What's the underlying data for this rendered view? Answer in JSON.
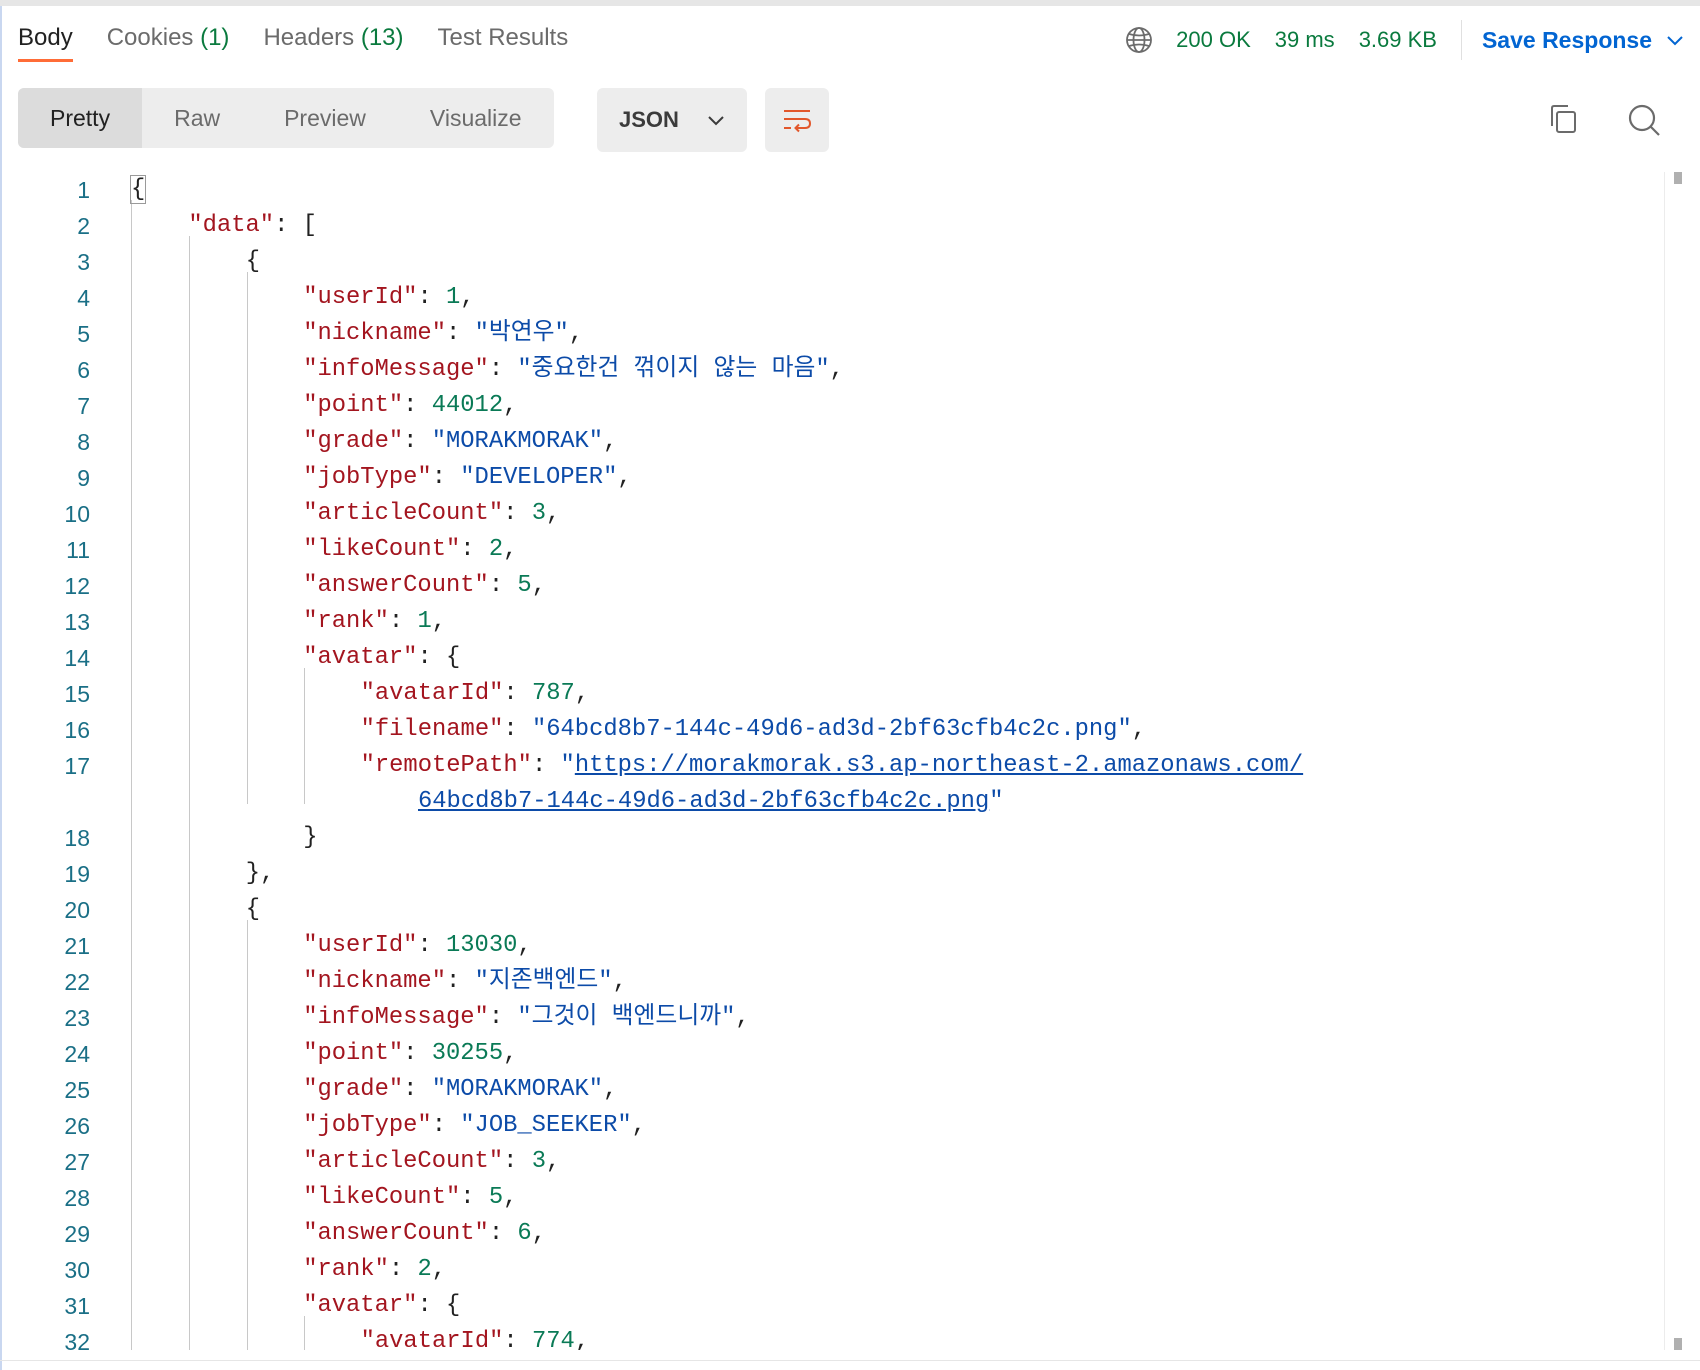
{
  "tabs": {
    "body": "Body",
    "cookies": "Cookies",
    "cookies_count": "(1)",
    "headers": "Headers",
    "headers_count": "(13)",
    "test_results": "Test Results"
  },
  "status": {
    "code": "200 OK",
    "time": "39 ms",
    "size": "3.69 KB",
    "save_label": "Save Response"
  },
  "toolbar": {
    "views": [
      "Pretty",
      "Raw",
      "Preview",
      "Visualize"
    ],
    "active_view": "Pretty",
    "format": "JSON"
  },
  "colors": {
    "key": "#a3151f",
    "string": "#0c4ba8",
    "number": "#0a7a56",
    "status_ok": "#0a7a3e",
    "accent": "#ff6c37",
    "link": "#0265d2"
  },
  "icons": {
    "globe": "globe-icon",
    "chevron": "chevron-down-icon",
    "wrap": "wrap-lines-icon",
    "copy": "copy-icon",
    "search": "search-icon"
  },
  "lines": [
    {
      "n": "1",
      "indent": 0,
      "t": [
        [
          "p",
          "{"
        ]
      ]
    },
    {
      "n": "2",
      "indent": 1,
      "t": [
        [
          "k",
          "\"data\""
        ],
        [
          "p",
          ": ["
        ]
      ]
    },
    {
      "n": "3",
      "indent": 2,
      "t": [
        [
          "p",
          "{"
        ]
      ]
    },
    {
      "n": "4",
      "indent": 3,
      "t": [
        [
          "k",
          "\"userId\""
        ],
        [
          "p",
          ": "
        ],
        [
          "n",
          "1"
        ],
        [
          "p",
          ","
        ]
      ]
    },
    {
      "n": "5",
      "indent": 3,
      "t": [
        [
          "k",
          "\"nickname\""
        ],
        [
          "p",
          ": "
        ],
        [
          "s",
          "\"박연우\""
        ],
        [
          "p",
          ","
        ]
      ]
    },
    {
      "n": "6",
      "indent": 3,
      "t": [
        [
          "k",
          "\"infoMessage\""
        ],
        [
          "p",
          ": "
        ],
        [
          "s",
          "\"중요한건 꺾이지 않는 마음\""
        ],
        [
          "p",
          ","
        ]
      ]
    },
    {
      "n": "7",
      "indent": 3,
      "t": [
        [
          "k",
          "\"point\""
        ],
        [
          "p",
          ": "
        ],
        [
          "n",
          "44012"
        ],
        [
          "p",
          ","
        ]
      ]
    },
    {
      "n": "8",
      "indent": 3,
      "t": [
        [
          "k",
          "\"grade\""
        ],
        [
          "p",
          ": "
        ],
        [
          "s",
          "\"MORAKMORAK\""
        ],
        [
          "p",
          ","
        ]
      ]
    },
    {
      "n": "9",
      "indent": 3,
      "t": [
        [
          "k",
          "\"jobType\""
        ],
        [
          "p",
          ": "
        ],
        [
          "s",
          "\"DEVELOPER\""
        ],
        [
          "p",
          ","
        ]
      ]
    },
    {
      "n": "10",
      "indent": 3,
      "t": [
        [
          "k",
          "\"articleCount\""
        ],
        [
          "p",
          ": "
        ],
        [
          "n",
          "3"
        ],
        [
          "p",
          ","
        ]
      ]
    },
    {
      "n": "11",
      "indent": 3,
      "t": [
        [
          "k",
          "\"likeCount\""
        ],
        [
          "p",
          ": "
        ],
        [
          "n",
          "2"
        ],
        [
          "p",
          ","
        ]
      ]
    },
    {
      "n": "12",
      "indent": 3,
      "t": [
        [
          "k",
          "\"answerCount\""
        ],
        [
          "p",
          ": "
        ],
        [
          "n",
          "5"
        ],
        [
          "p",
          ","
        ]
      ]
    },
    {
      "n": "13",
      "indent": 3,
      "t": [
        [
          "k",
          "\"rank\""
        ],
        [
          "p",
          ": "
        ],
        [
          "n",
          "1"
        ],
        [
          "p",
          ","
        ]
      ]
    },
    {
      "n": "14",
      "indent": 3,
      "t": [
        [
          "k",
          "\"avatar\""
        ],
        [
          "p",
          ": {"
        ]
      ]
    },
    {
      "n": "15",
      "indent": 4,
      "t": [
        [
          "k",
          "\"avatarId\""
        ],
        [
          "p",
          ": "
        ],
        [
          "n",
          "787"
        ],
        [
          "p",
          ","
        ]
      ]
    },
    {
      "n": "16",
      "indent": 4,
      "t": [
        [
          "k",
          "\"filename\""
        ],
        [
          "p",
          ": "
        ],
        [
          "s",
          "\"64bcd8b7-144c-49d6-ad3d-2bf63cfb4c2c.png\""
        ],
        [
          "p",
          ","
        ]
      ]
    },
    {
      "n": "17",
      "indent": 4,
      "wrap": true,
      "t": [
        [
          "k",
          "\"remotePath\""
        ],
        [
          "p",
          ": "
        ],
        [
          "s",
          "\""
        ],
        [
          "url",
          "https://morakmorak.s3.ap-northeast-2.amazonaws.com/"
        ]
      ],
      "t2": [
        [
          "url",
          "64bcd8b7-144c-49d6-ad3d-2bf63cfb4c2c.png"
        ],
        [
          "s",
          "\""
        ]
      ]
    },
    {
      "n": "18",
      "indent": 3,
      "t": [
        [
          "p",
          "}"
        ]
      ]
    },
    {
      "n": "19",
      "indent": 2,
      "t": [
        [
          "p",
          "},"
        ]
      ]
    },
    {
      "n": "20",
      "indent": 2,
      "t": [
        [
          "p",
          "{"
        ]
      ]
    },
    {
      "n": "21",
      "indent": 3,
      "t": [
        [
          "k",
          "\"userId\""
        ],
        [
          "p",
          ": "
        ],
        [
          "n",
          "13030"
        ],
        [
          "p",
          ","
        ]
      ]
    },
    {
      "n": "22",
      "indent": 3,
      "t": [
        [
          "k",
          "\"nickname\""
        ],
        [
          "p",
          ": "
        ],
        [
          "s",
          "\"지존백엔드\""
        ],
        [
          "p",
          ","
        ]
      ]
    },
    {
      "n": "23",
      "indent": 3,
      "t": [
        [
          "k",
          "\"infoMessage\""
        ],
        [
          "p",
          ": "
        ],
        [
          "s",
          "\"그것이 백엔드니까\""
        ],
        [
          "p",
          ","
        ]
      ]
    },
    {
      "n": "24",
      "indent": 3,
      "t": [
        [
          "k",
          "\"point\""
        ],
        [
          "p",
          ": "
        ],
        [
          "n",
          "30255"
        ],
        [
          "p",
          ","
        ]
      ]
    },
    {
      "n": "25",
      "indent": 3,
      "t": [
        [
          "k",
          "\"grade\""
        ],
        [
          "p",
          ": "
        ],
        [
          "s",
          "\"MORAKMORAK\""
        ],
        [
          "p",
          ","
        ]
      ]
    },
    {
      "n": "26",
      "indent": 3,
      "t": [
        [
          "k",
          "\"jobType\""
        ],
        [
          "p",
          ": "
        ],
        [
          "s",
          "\"JOB_SEEKER\""
        ],
        [
          "p",
          ","
        ]
      ]
    },
    {
      "n": "27",
      "indent": 3,
      "t": [
        [
          "k",
          "\"articleCount\""
        ],
        [
          "p",
          ": "
        ],
        [
          "n",
          "3"
        ],
        [
          "p",
          ","
        ]
      ]
    },
    {
      "n": "28",
      "indent": 3,
      "t": [
        [
          "k",
          "\"likeCount\""
        ],
        [
          "p",
          ": "
        ],
        [
          "n",
          "5"
        ],
        [
          "p",
          ","
        ]
      ]
    },
    {
      "n": "29",
      "indent": 3,
      "t": [
        [
          "k",
          "\"answerCount\""
        ],
        [
          "p",
          ": "
        ],
        [
          "n",
          "6"
        ],
        [
          "p",
          ","
        ]
      ]
    },
    {
      "n": "30",
      "indent": 3,
      "t": [
        [
          "k",
          "\"rank\""
        ],
        [
          "p",
          ": "
        ],
        [
          "n",
          "2"
        ],
        [
          "p",
          ","
        ]
      ]
    },
    {
      "n": "31",
      "indent": 3,
      "t": [
        [
          "k",
          "\"avatar\""
        ],
        [
          "p",
          ": {"
        ]
      ]
    },
    {
      "n": "32",
      "indent": 4,
      "t": [
        [
          "k",
          "\"avatarId\""
        ],
        [
          "p",
          ": "
        ],
        [
          "n",
          "774"
        ],
        [
          "p",
          ","
        ]
      ]
    }
  ]
}
